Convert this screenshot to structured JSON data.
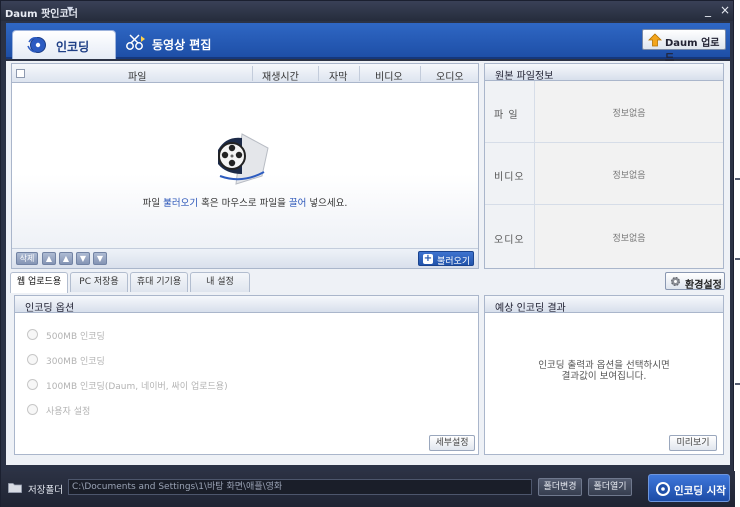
{
  "window": {
    "title": "Daum 팟인코더",
    "title_dropdown_glyph": "▼",
    "minimize_glyph": "_",
    "close_glyph": "×"
  },
  "modes": {
    "tabs": [
      {
        "label": "인코딩",
        "icon": "encoding-disc-icon",
        "active": true
      },
      {
        "label": "동영상 편집",
        "icon": "movie-edit-icon",
        "active": false
      }
    ],
    "upload_button": {
      "label": "Daum 업로드",
      "icon": "upload-arrow-icon"
    }
  },
  "file_list": {
    "columns": [
      "파일",
      "재생시간",
      "자막",
      "비디오",
      "오디오"
    ],
    "drop_message": {
      "before": "파일 ",
      "link1": "불러오기",
      "middle": " 혹은 마우스로 파일을 ",
      "link2": "끌어",
      "after": " 넣으세요."
    },
    "footer_buttons": [
      "삭제",
      "▲",
      "▲",
      "▼",
      "▼"
    ],
    "load_button": {
      "label": "불러오기",
      "icon_glyph": "+"
    }
  },
  "source_info": {
    "title": "원본 파일정보",
    "rows": [
      {
        "key": "파 일",
        "value": "정보없음"
      },
      {
        "key": "비디오",
        "value": "정보없음"
      },
      {
        "key": "오디오",
        "value": "정보없음"
      }
    ]
  },
  "option_tabs": {
    "tabs": [
      "웹 업로드용",
      "PC 저장용",
      "휴대 기기용",
      "내 설정"
    ],
    "active_index": 0,
    "env_button": {
      "label": "환경설정",
      "icon": "gear-icon"
    }
  },
  "encoding_options": {
    "title": "인코딩 옵션",
    "options": [
      "500MB 인코딩",
      "300MB 인코딩",
      "100MB 인코딩(Daum, 네이버, 싸이 업로드용)",
      "사용자 설정"
    ],
    "detail_button": "세부설정"
  },
  "result": {
    "title": "예상 인코딩 결과",
    "message_line1": "인코딩 출력과 옵션을 선택하시면",
    "message_line2": "결과값이 보여집니다.",
    "preview_button": "미리보기"
  },
  "bottom": {
    "save_folder_label": "저장폴더",
    "path": "C:\\Documents and Settings\\1\\바탕 화면\\애플\\영화",
    "change_folder_button": "폴더변경",
    "open_folder_button": "폴더열기",
    "start_button": "인코딩 시작"
  }
}
